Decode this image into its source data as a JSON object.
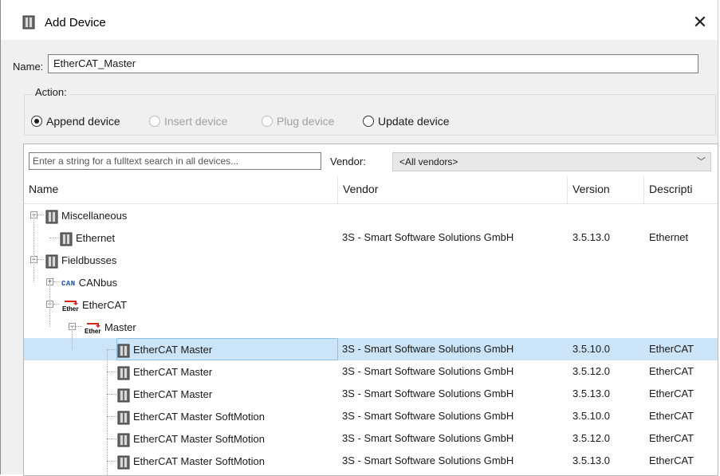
{
  "window": {
    "title": "Add Device",
    "close_glyph": "✕"
  },
  "name_field": {
    "label": "Name:",
    "value": "EtherCAT_Master"
  },
  "action": {
    "label": "Action:",
    "options": [
      {
        "label": "Append device",
        "checked": true,
        "enabled": true
      },
      {
        "label": "Insert device",
        "checked": false,
        "enabled": false
      },
      {
        "label": "Plug device",
        "checked": false,
        "enabled": false
      },
      {
        "label": "Update device",
        "checked": false,
        "enabled": true
      }
    ]
  },
  "search": {
    "placeholder": "Enter a string for a fulltext search in all devices..."
  },
  "vendor": {
    "label": "Vendor:",
    "selected": "<All vendors>"
  },
  "columns": [
    "Name",
    "Vendor",
    "Version",
    "Descripti"
  ],
  "tree": [
    {
      "name": "Miscellaneous",
      "vendor": "",
      "version": "",
      "desc": "",
      "level": 0,
      "expander": "−",
      "icon": "device-icon"
    },
    {
      "name": "Ethernet",
      "vendor": "3S - Smart Software Solutions GmbH",
      "version": "3.5.13.0",
      "desc": "Ethernet",
      "level": 1,
      "expander": "",
      "icon": "device-icon"
    },
    {
      "name": "Fieldbusses",
      "vendor": "",
      "version": "",
      "desc": "",
      "level": 0,
      "expander": "−",
      "icon": "device-icon"
    },
    {
      "name": "CANbus",
      "vendor": "",
      "version": "",
      "desc": "",
      "level": 1,
      "expander": "+",
      "icon": "can-icon"
    },
    {
      "name": "EtherCAT",
      "vendor": "",
      "version": "",
      "desc": "",
      "level": 1,
      "expander": "−",
      "icon": "ethercat-icon"
    },
    {
      "name": "Master",
      "vendor": "",
      "version": "",
      "desc": "",
      "level": 2,
      "expander": "−",
      "icon": "ethercat-icon"
    },
    {
      "name": "EtherCAT Master",
      "vendor": "3S - Smart Software Solutions GmbH",
      "version": "3.5.10.0",
      "desc": "EtherCAT",
      "level": 3,
      "expander": "",
      "icon": "device-icon",
      "selected": true
    },
    {
      "name": "EtherCAT Master",
      "vendor": "3S - Smart Software Solutions GmbH",
      "version": "3.5.12.0",
      "desc": "EtherCAT",
      "level": 3,
      "expander": "",
      "icon": "device-icon"
    },
    {
      "name": "EtherCAT Master",
      "vendor": "3S - Smart Software Solutions GmbH",
      "version": "3.5.13.0",
      "desc": "EtherCAT",
      "level": 3,
      "expander": "",
      "icon": "device-icon"
    },
    {
      "name": "EtherCAT Master SoftMotion",
      "vendor": "3S - Smart Software Solutions GmbH",
      "version": "3.5.10.0",
      "desc": "EtherCAT",
      "level": 3,
      "expander": "",
      "icon": "device-icon"
    },
    {
      "name": "EtherCAT Master SoftMotion",
      "vendor": "3S - Smart Software Solutions GmbH",
      "version": "3.5.12.0",
      "desc": "EtherCAT",
      "level": 3,
      "expander": "",
      "icon": "device-icon"
    },
    {
      "name": "EtherCAT Master SoftMotion",
      "vendor": "3S - Smart Software Solutions GmbH",
      "version": "3.5.13.0",
      "desc": "EtherCAT",
      "level": 3,
      "expander": "",
      "icon": "device-icon"
    }
  ],
  "icon_labels": {
    "can": "CAN",
    "ethercat": "EtherCAT"
  },
  "colors": {
    "selection": "#cce4f7",
    "selection_border": "#8dc3e8",
    "can_text": "#1a4fa3",
    "ethercat_arrow": "#d9261c"
  }
}
